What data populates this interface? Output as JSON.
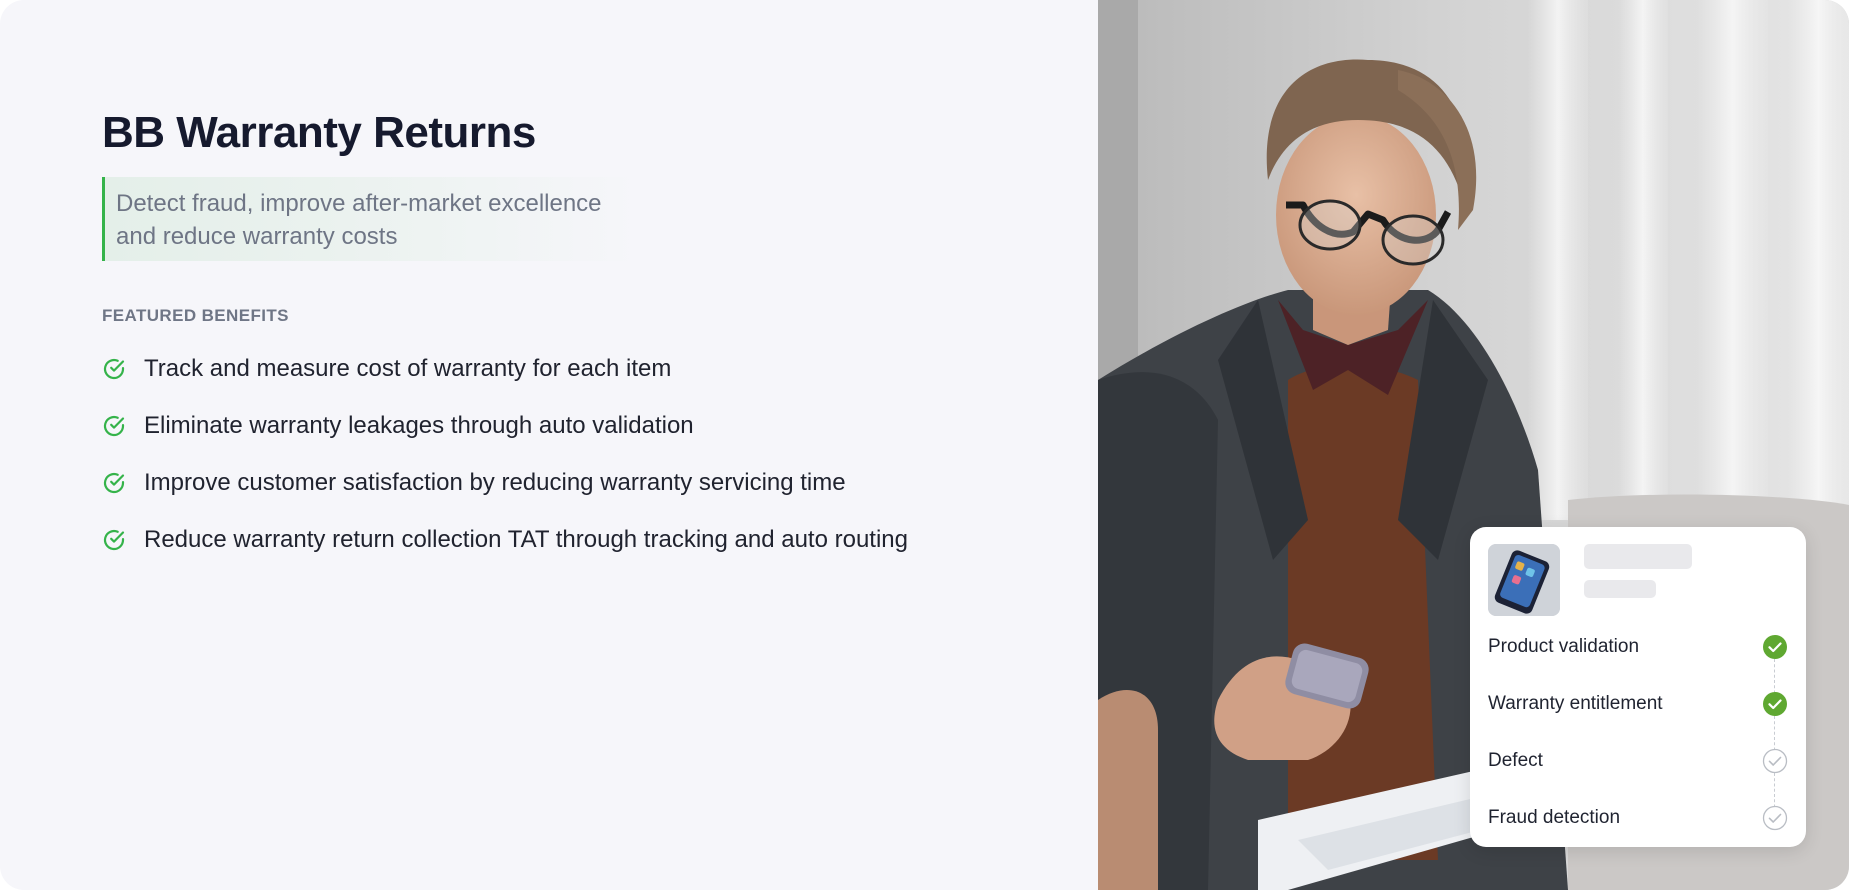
{
  "hero": {
    "title": "BB Warranty Returns",
    "subtitle_lines": [
      "Detect fraud, improve after-market excellence",
      "and reduce warranty costs"
    ]
  },
  "benefits": {
    "heading": "FEATURED BENEFITS",
    "items": [
      {
        "icon": "check-circle-icon",
        "text": "Track and measure cost of warranty for each item"
      },
      {
        "icon": "check-circle-icon",
        "text": "Eliminate warranty leakages through auto validation"
      },
      {
        "icon": "check-circle-icon",
        "text": "Improve customer satisfaction by reducing warranty servicing time"
      },
      {
        "icon": "check-circle-icon",
        "text": "Reduce warranty return collection TAT through tracking and auto routing"
      }
    ]
  },
  "status_card": {
    "thumbnail": "smartphone-image",
    "steps": [
      {
        "label": "Product validation",
        "status": "complete"
      },
      {
        "label": "Warranty entitlement",
        "status": "complete"
      },
      {
        "label": "Defect",
        "status": "pending"
      },
      {
        "label": "Fraud detection",
        "status": "pending"
      }
    ]
  },
  "colors": {
    "accent_green": "#35b34a",
    "complete_green": "#5fa831",
    "pending_gray": "#b9bdc4",
    "title": "#161a2e",
    "muted_text": "#6e7585",
    "background": "#f6f6fa"
  },
  "photo": "man-reading-phone-photo"
}
